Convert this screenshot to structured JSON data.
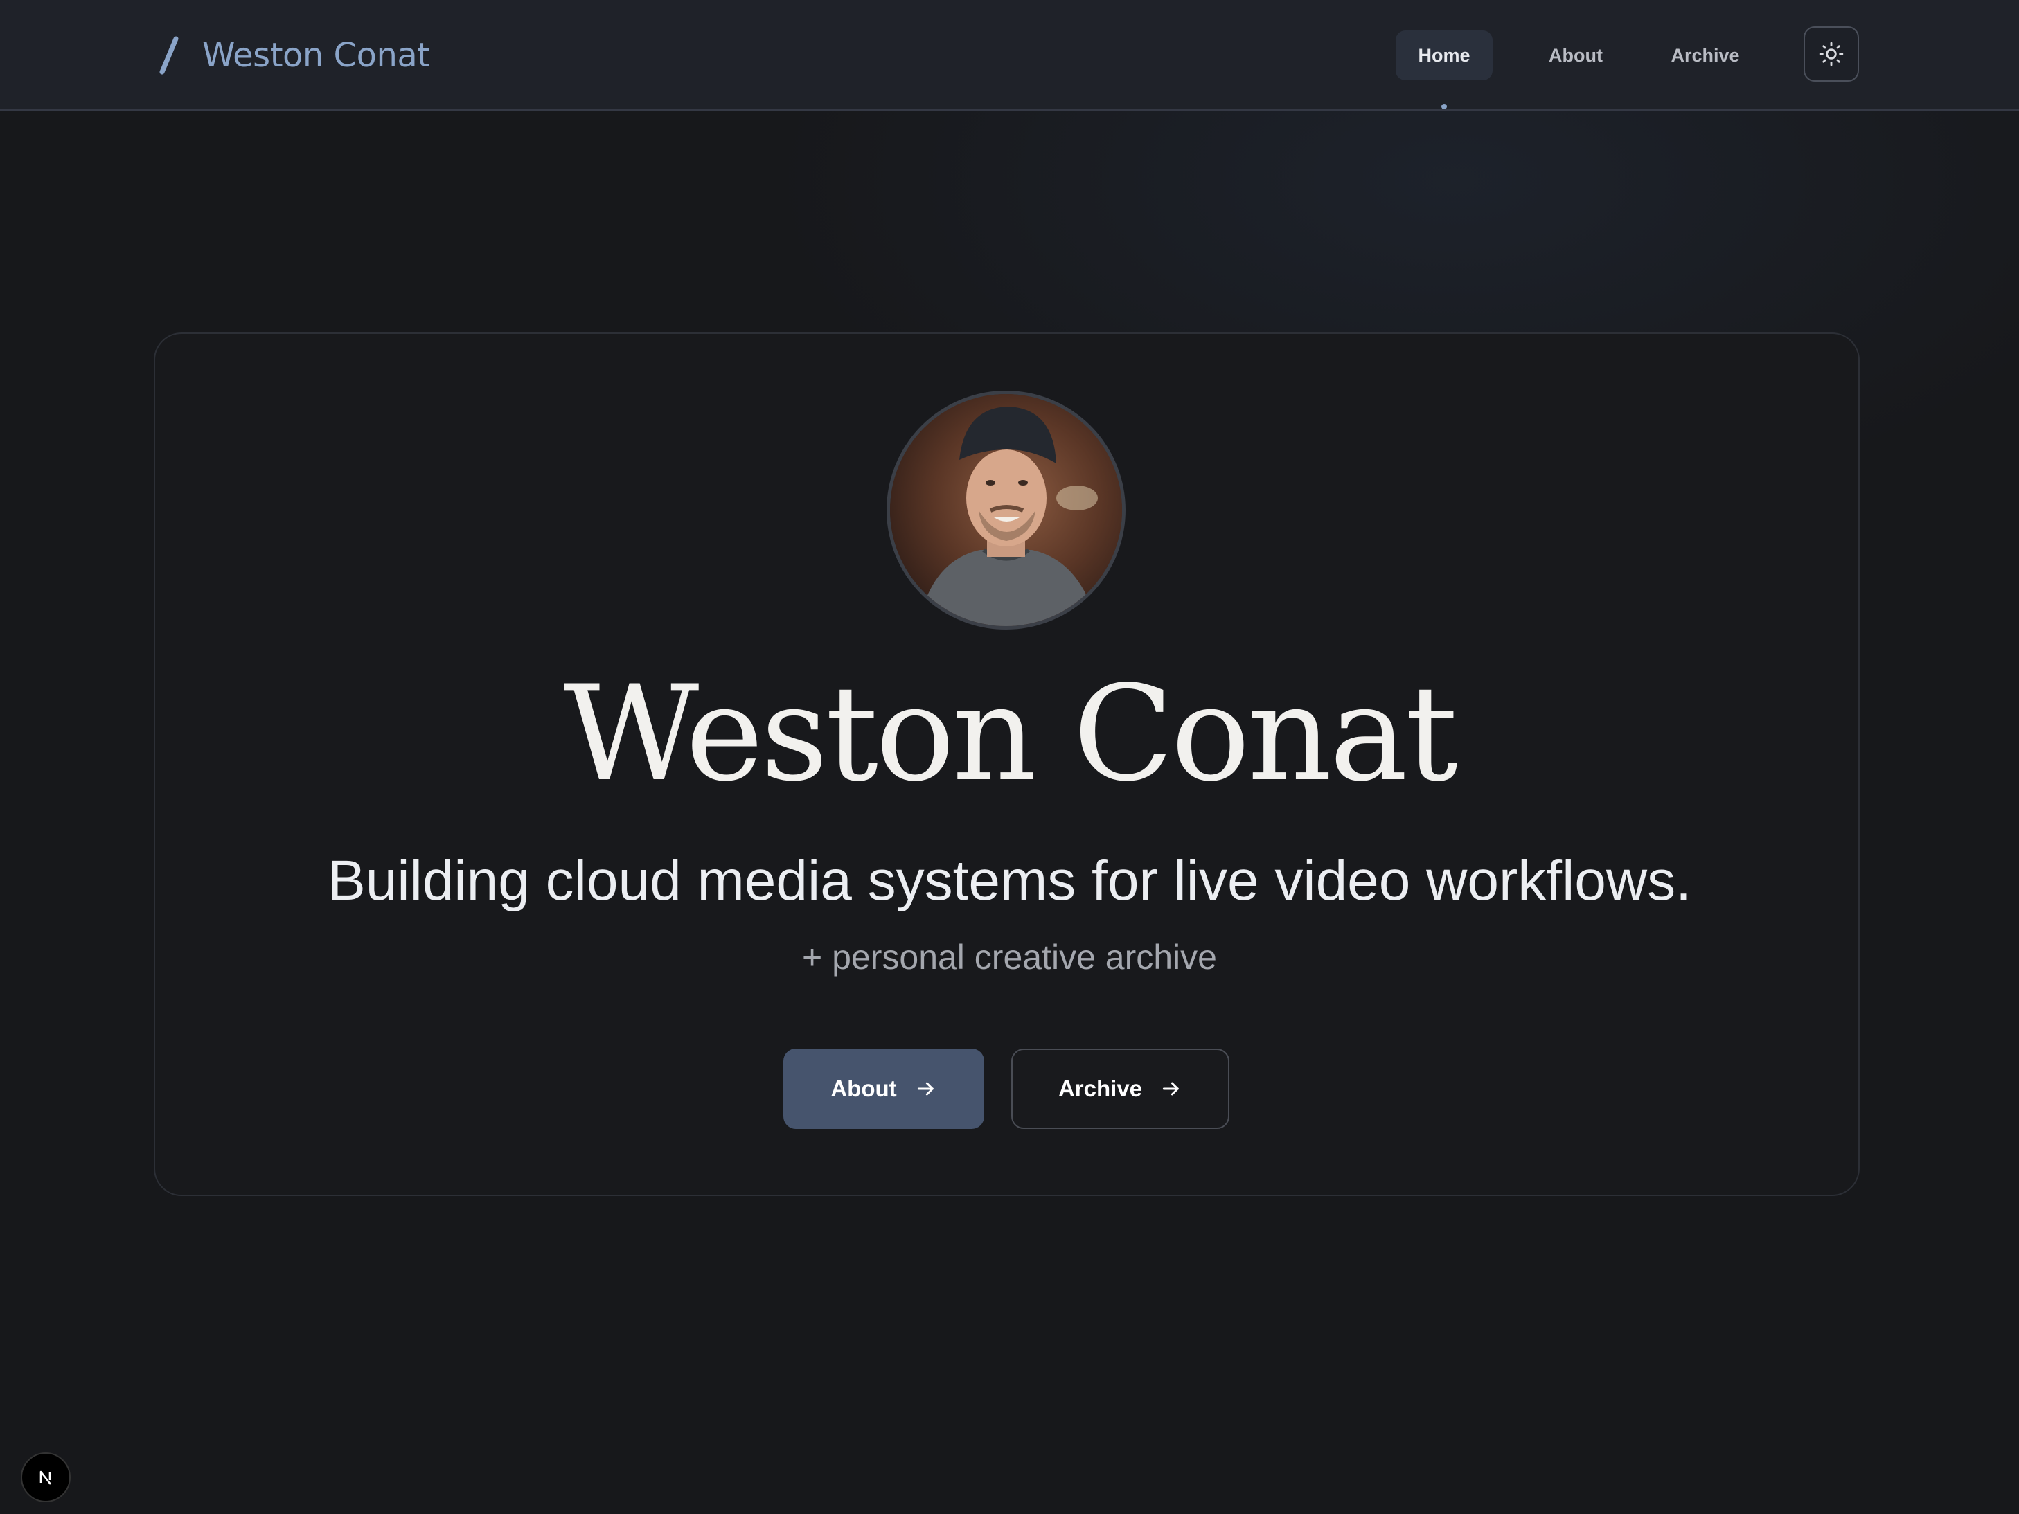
{
  "brand": {
    "name": "Weston Conat",
    "logo_icon": "slash-icon",
    "accent_color": "#8aa4c8"
  },
  "nav": {
    "items": [
      {
        "label": "Home",
        "active": true
      },
      {
        "label": "About",
        "active": false
      },
      {
        "label": "Archive",
        "active": false
      }
    ],
    "theme_toggle_icon": "sun-icon"
  },
  "hero": {
    "avatar": "profile-photo",
    "name": "Weston Conat",
    "tagline": "Building cloud media systems for live video workflows.",
    "subtagline": "+ personal creative archive",
    "buttons": {
      "primary": {
        "label": "About",
        "icon": "arrow-right-icon",
        "color": "#46546d"
      },
      "secondary": {
        "label": "Archive",
        "icon": "arrow-right-icon"
      }
    }
  },
  "dev_badge": {
    "label": "N",
    "icon": "nextjs-icon"
  },
  "colors": {
    "background": "#17181b",
    "header": "#1f2229",
    "text": "#f2f1ee"
  }
}
